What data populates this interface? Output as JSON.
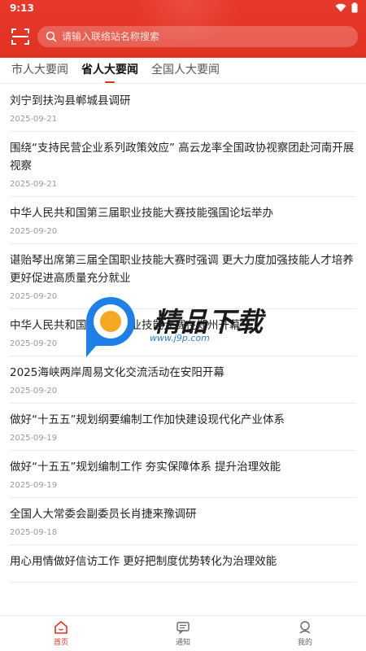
{
  "status_bar": {
    "time": "9:13"
  },
  "header": {
    "search_placeholder": "请输入联络站名称搜索"
  },
  "tabs": [
    {
      "label": "市人大要闻",
      "active": false
    },
    {
      "label": "省人大要闻",
      "active": true
    },
    {
      "label": "全国人大要闻",
      "active": false
    }
  ],
  "news": [
    {
      "title": "刘宁到扶沟县郸城县调研",
      "date": "2025-09-21"
    },
    {
      "title": "围绕“支持民营企业系列政策效应” 高云龙率全国政协视察团赴河南开展视察",
      "date": "2025-09-21"
    },
    {
      "title": "中华人民共和国第三届职业技能大赛技能强国论坛举办",
      "date": "2025-09-20"
    },
    {
      "title": "谌贻琴出席第三届全国职业技能大赛时强调 更大力度加强技能人才培养 更好促进高质量充分就业",
      "date": "2025-09-20"
    },
    {
      "title": "中华人民共和国第三届职业技能大赛在郑州开幕",
      "date": "2025-09-20"
    },
    {
      "title": "2025海峡两岸周易文化交流活动在安阳开幕",
      "date": "2025-09-20"
    },
    {
      "title": "做好“十五五”规划纲要编制工作加快建设现代化产业体系",
      "date": "2025-09-19"
    },
    {
      "title": "做好“十五五”规划编制工作 夯实保障体系 提升治理效能",
      "date": "2025-09-19"
    },
    {
      "title": "全国人大常委会副委员长肖捷来豫调研",
      "date": "2025-09-18"
    },
    {
      "title": "用心用情做好信访工作 更好把制度优势转化为治理效能",
      "date": ""
    }
  ],
  "watermark": {
    "text": "精品下载",
    "url": "www.j9p.com"
  },
  "bottom_nav": [
    {
      "label": "首页",
      "icon": "home-icon",
      "active": true
    },
    {
      "label": "通知",
      "icon": "notice-icon",
      "active": false
    },
    {
      "label": "我的",
      "icon": "profile-icon",
      "active": false
    }
  ],
  "colors": {
    "accent": "#e23222",
    "text": "#222222",
    "date": "#9a9a9a"
  }
}
